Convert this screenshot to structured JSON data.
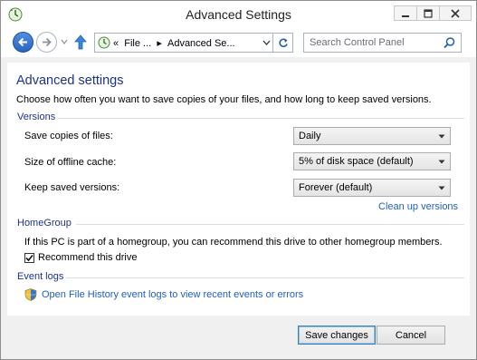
{
  "window": {
    "title": "Advanced Settings"
  },
  "nav": {
    "address_prefix": "«",
    "breadcrumb": [
      "File ...",
      "Advanced Se..."
    ],
    "breadcrumb_sep": "▸",
    "search_placeholder": "Search Control Panel"
  },
  "page": {
    "heading": "Advanced settings",
    "description": "Choose how often you want to save copies of your files, and how long to keep saved versions."
  },
  "versions": {
    "group_title": "Versions",
    "rows": [
      {
        "label": "Save copies of files:",
        "value": "Daily"
      },
      {
        "label": "Size of offline cache:",
        "value": "5% of disk space (default)"
      },
      {
        "label": "Keep saved versions:",
        "value": "Forever (default)"
      }
    ],
    "cleanup_link": "Clean up versions"
  },
  "homegroup": {
    "group_title": "HomeGroup",
    "text": "If this PC is part of a homegroup, you can recommend this drive to other homegroup members.",
    "checkbox_label": "Recommend this drive",
    "checked": true
  },
  "eventlogs": {
    "group_title": "Event logs",
    "link": "Open File History event logs to view recent events or errors"
  },
  "footer": {
    "save_label": "Save changes",
    "cancel_label": "Cancel"
  },
  "colors": {
    "heading": "#1e3287",
    "link": "#1f5fbf",
    "back_button": "#2a64c2"
  }
}
